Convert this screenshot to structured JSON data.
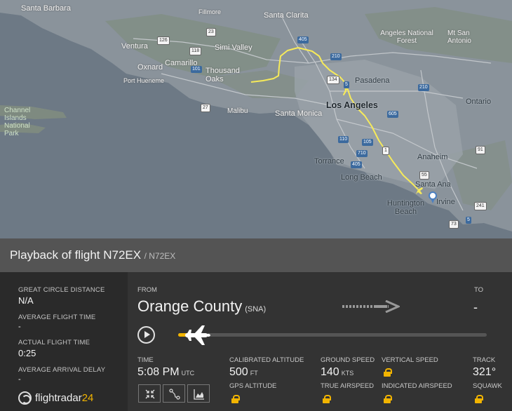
{
  "map": {
    "labels": {
      "santa_barbara": "Santa Barbara",
      "fillmore": "Fillmore",
      "santa_clarita": "Santa Clarita",
      "ventura": "Ventura",
      "simi_valley": "Simi Valley",
      "oxnard": "Oxnard",
      "camarillo": "Camarillo",
      "thousand_oaks": "Thousand Oaks",
      "port_hueneme": "Port Hueneme",
      "pasadena": "Pasadena",
      "angeles_nf": "Angeles National Forest",
      "mt_san_antonio": "Mt San Antonio",
      "malibu": "Malibu",
      "santa_monica": "Santa Monica",
      "los_angeles": "Los Angeles",
      "ontario": "Ontario",
      "channel_islands": "Channel Islands National Park",
      "torrance": "Torrance",
      "anaheim": "Anaheim",
      "long_beach": "Long Beach",
      "santa_ana": "Santa Ana",
      "huntington_beach": "Huntington Beach",
      "irvine": "Irvine"
    },
    "shields": [
      "126",
      "23",
      "405",
      "210",
      "118",
      "101",
      "134",
      "5",
      "210",
      "605",
      "110",
      "105",
      "710",
      "405",
      "91",
      "55",
      "241",
      "73",
      "5",
      "1",
      "27"
    ],
    "colors": {
      "track": "#f6ea5a",
      "land": "#7d8893",
      "water": "#6c7883"
    },
    "airport_icon": "location-pin-icon"
  },
  "header": {
    "title": "Playback of flight N72EX",
    "sub": "/ N72EX"
  },
  "stats": {
    "gcd_label": "GREAT CIRCLE DISTANCE",
    "gcd_value": "N/A",
    "aft_label": "AVERAGE FLIGHT TIME",
    "aft_value": "-",
    "actual_label": "ACTUAL FLIGHT TIME",
    "actual_value": "0:25",
    "delay_label": "AVERAGE ARRIVAL DELAY",
    "delay_value": "-"
  },
  "brand": {
    "prefix": "flightradar",
    "suffix": "24"
  },
  "route": {
    "from_label": "FROM",
    "from_name": "Orange County",
    "from_code": "(SNA)",
    "to_label": "TO",
    "to_value": "-"
  },
  "playback": {
    "progress": 0.06,
    "play_icon": "play-icon",
    "plane_icon": "airplane-icon"
  },
  "telemetry": {
    "time_label": "TIME",
    "time_value": "5:08 PM",
    "time_unit": "UTC",
    "cal_alt_label": "CALIBRATED ALTITUDE",
    "cal_alt_value": "500",
    "cal_alt_unit": "FT",
    "gps_alt_label": "GPS ALTITUDE",
    "ground_speed_label": "GROUND SPEED",
    "ground_speed_value": "140",
    "ground_speed_unit": "KTS",
    "true_airspeed_label": "TRUE AIRSPEED",
    "vertical_speed_label": "VERTICAL SPEED",
    "indicated_airspeed_label": "INDICATED AIRSPEED",
    "track_label": "TRACK",
    "track_value": "321°",
    "squawk_label": "SQUAWK"
  },
  "controls": [
    "collapse-icon",
    "route-icon",
    "chart-icon"
  ],
  "accent": "#f2b400"
}
